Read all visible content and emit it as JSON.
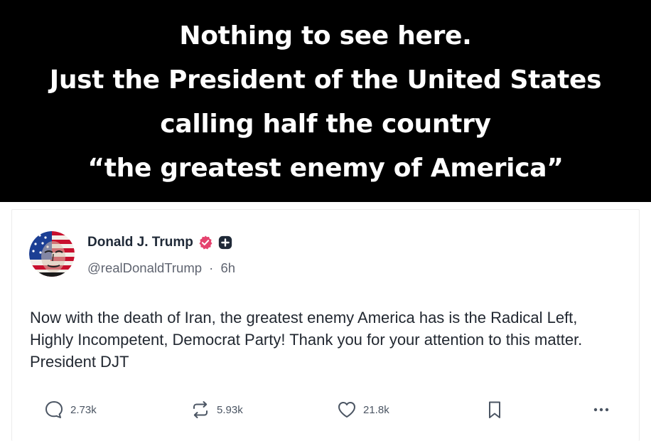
{
  "banner": {
    "lines": [
      "Nothing to see here.",
      "Just the President of the United States",
      "calling half the country",
      "“the greatest enemy of America”"
    ]
  },
  "post": {
    "author": {
      "display_name": "Donald J. Trump",
      "handle": "@realDonaldTrump",
      "separator": "·",
      "time": "6h"
    },
    "text": "Now with the death of Iran, the greatest enemy America has is the Radical Left, Highly Incompetent, Democrat Party! Thank you for your attention to this matter. President DJT",
    "actions": {
      "replies": "2.73k",
      "reposts": "5.93k",
      "likes": "21.8k"
    }
  },
  "icons": {
    "reply": "speech-bubble-icon",
    "repost": "repost-arrows-icon",
    "like": "heart-icon",
    "bookmark": "bookmark-icon",
    "more": "more-dots-icon",
    "verified": "verified-badge-icon",
    "plus": "plus-badge-icon"
  },
  "colors": {
    "banner_bg": "#000000",
    "banner_text": "#ffffff",
    "verified_badge": "#e5426e",
    "plus_badge": "#1f2937",
    "text": "#222831",
    "muted": "#5f6470"
  }
}
